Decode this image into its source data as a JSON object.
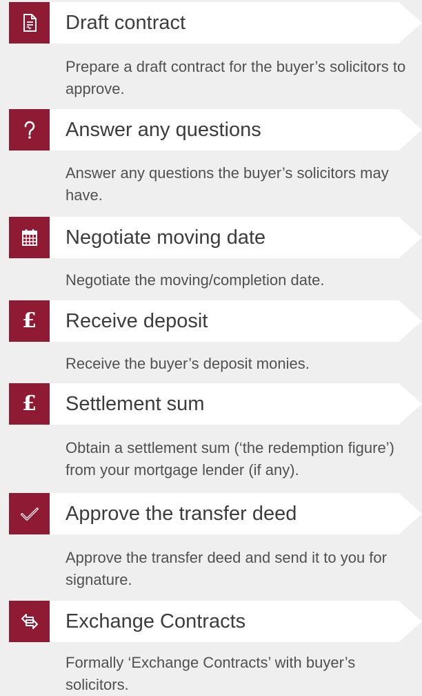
{
  "steps": [
    {
      "title": "Draft contract",
      "description": "Prepare a draft contract for the buyer’s solicitors to approve.",
      "icon": "document-icon"
    },
    {
      "title": " Answer any questions",
      "description": "Answer any questions the buyer’s solicitors may have.",
      "icon": "question-icon"
    },
    {
      "title": "Negotiate moving date",
      "description": "Negotiate the moving/completion date.",
      "icon": "calendar-icon"
    },
    {
      "title": "Receive deposit",
      "description": "Receive the buyer’s deposit monies.",
      "icon": "pound-icon"
    },
    {
      "title": "Settlement sum",
      "description": "Obtain a settlement sum (‘the redemption figure’) from your mortgage lender (if any).",
      "icon": "pound-icon"
    },
    {
      "title": "Approve the transfer deed",
      "description": "Approve the transfer deed and send it to you for signature.",
      "icon": "checkmark-icon"
    },
    {
      "title": "Exchange Contracts",
      "description": "Formally ‘Exchange Contracts’ with buyer’s solicitors.",
      "icon": "exchange-icon"
    }
  ],
  "colors": {
    "accent": "#8e1a33",
    "background": "#efefef",
    "bar": "#ffffff"
  }
}
